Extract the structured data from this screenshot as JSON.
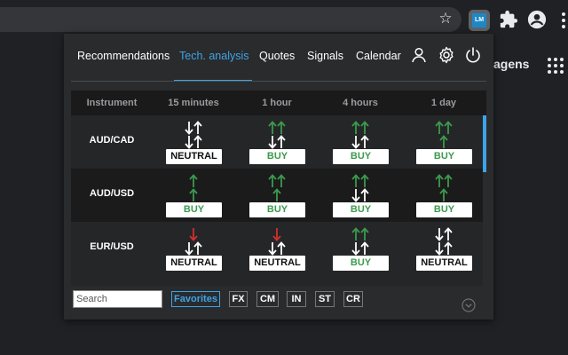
{
  "browser": {
    "bg_text": "agens"
  },
  "nav": {
    "tabs": [
      {
        "label": "Recommendations"
      },
      {
        "label": "Tech. analysis"
      },
      {
        "label": "Quotes"
      },
      {
        "label": "Signals"
      },
      {
        "label": "Calendar"
      }
    ],
    "active_tab": 1
  },
  "table": {
    "headers": [
      "Instrument",
      "15 minutes",
      "1 hour",
      "4 hours",
      "1 day"
    ],
    "rows": [
      {
        "instrument": "AUD/CAD",
        "cells": [
          {
            "top": "mixed",
            "bottom": "mixed",
            "label": "NEUTRAL",
            "signal": "neutral"
          },
          {
            "top": "up",
            "bottom": "mixed",
            "label": "BUY",
            "signal": "buy"
          },
          {
            "top": "up",
            "bottom": "mixed",
            "label": "BUY",
            "signal": "buy"
          },
          {
            "top": "up",
            "bottom": "up-single",
            "label": "BUY",
            "signal": "buy"
          }
        ]
      },
      {
        "instrument": "AUD/USD",
        "cells": [
          {
            "top": "up-single",
            "bottom": "up-single",
            "label": "BUY",
            "signal": "buy"
          },
          {
            "top": "up",
            "bottom": "up-single",
            "label": "BUY",
            "signal": "buy"
          },
          {
            "top": "up",
            "bottom": "mixed",
            "label": "BUY",
            "signal": "buy"
          },
          {
            "top": "up",
            "bottom": "up-single",
            "label": "BUY",
            "signal": "buy"
          }
        ]
      },
      {
        "instrument": "EUR/USD",
        "cells": [
          {
            "top": "down-single",
            "bottom": "mixed",
            "label": "NEUTRAL",
            "signal": "neutral"
          },
          {
            "top": "down-single",
            "bottom": "mixed",
            "label": "NEUTRAL",
            "signal": "neutral"
          },
          {
            "top": "up",
            "bottom": "mixed",
            "label": "BUY",
            "signal": "buy"
          },
          {
            "top": "mixed",
            "bottom": "mixed",
            "label": "NEUTRAL",
            "signal": "neutral"
          }
        ]
      }
    ]
  },
  "footer": {
    "search_placeholder": "Search",
    "favorites_label": "Favorites",
    "filters": [
      "FX",
      "CM",
      "IN",
      "ST",
      "CR"
    ]
  },
  "colors": {
    "accent": "#3da4e8",
    "buy": "#3b9a4c",
    "sell": "#d32f2f",
    "neutral": "#ffffff"
  }
}
